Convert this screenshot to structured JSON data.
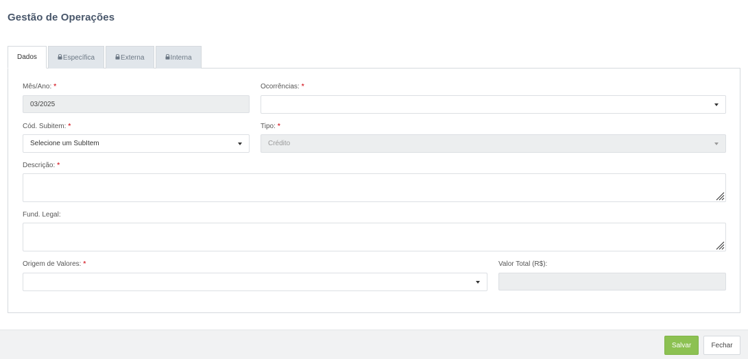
{
  "page": {
    "title": "Gestão de Operações"
  },
  "tabs": [
    {
      "label": "Dados",
      "active": true,
      "locked": false
    },
    {
      "label": "Específica",
      "active": false,
      "locked": true
    },
    {
      "label": "Externa",
      "active": false,
      "locked": true
    },
    {
      "label": "Interna",
      "active": false,
      "locked": true
    }
  ],
  "form": {
    "mes_ano": {
      "label": "Mês/Ano:",
      "required": "*",
      "value": "03/2025"
    },
    "ocorrencias": {
      "label": "Ocorrências:",
      "required": "*",
      "value": ""
    },
    "cod_subitem": {
      "label": "Cód. Subitem:",
      "required": "*",
      "value": "Selecione um SubItem"
    },
    "tipo": {
      "label": "Tipo:",
      "required": "*",
      "value": "Crédito"
    },
    "descricao": {
      "label": "Descrição:",
      "required": "*",
      "value": ""
    },
    "fund_legal": {
      "label": "Fund. Legal:",
      "value": ""
    },
    "origem_valores": {
      "label": "Origem de Valores:",
      "required": "*",
      "value": ""
    },
    "valor_total": {
      "label": "Valor Total (R$):",
      "value": ""
    }
  },
  "footer": {
    "save_label": "Salvar",
    "close_label": "Fechar"
  },
  "colors": {
    "save_button": "#8cc152",
    "required_mark": "#d9363e",
    "tab_inactive": "#e1e6eb"
  },
  "icons": {
    "tab_lock": "lock-icon",
    "select_caret": "caret-down-icon",
    "textarea_resize": "resize-grip-icon"
  }
}
